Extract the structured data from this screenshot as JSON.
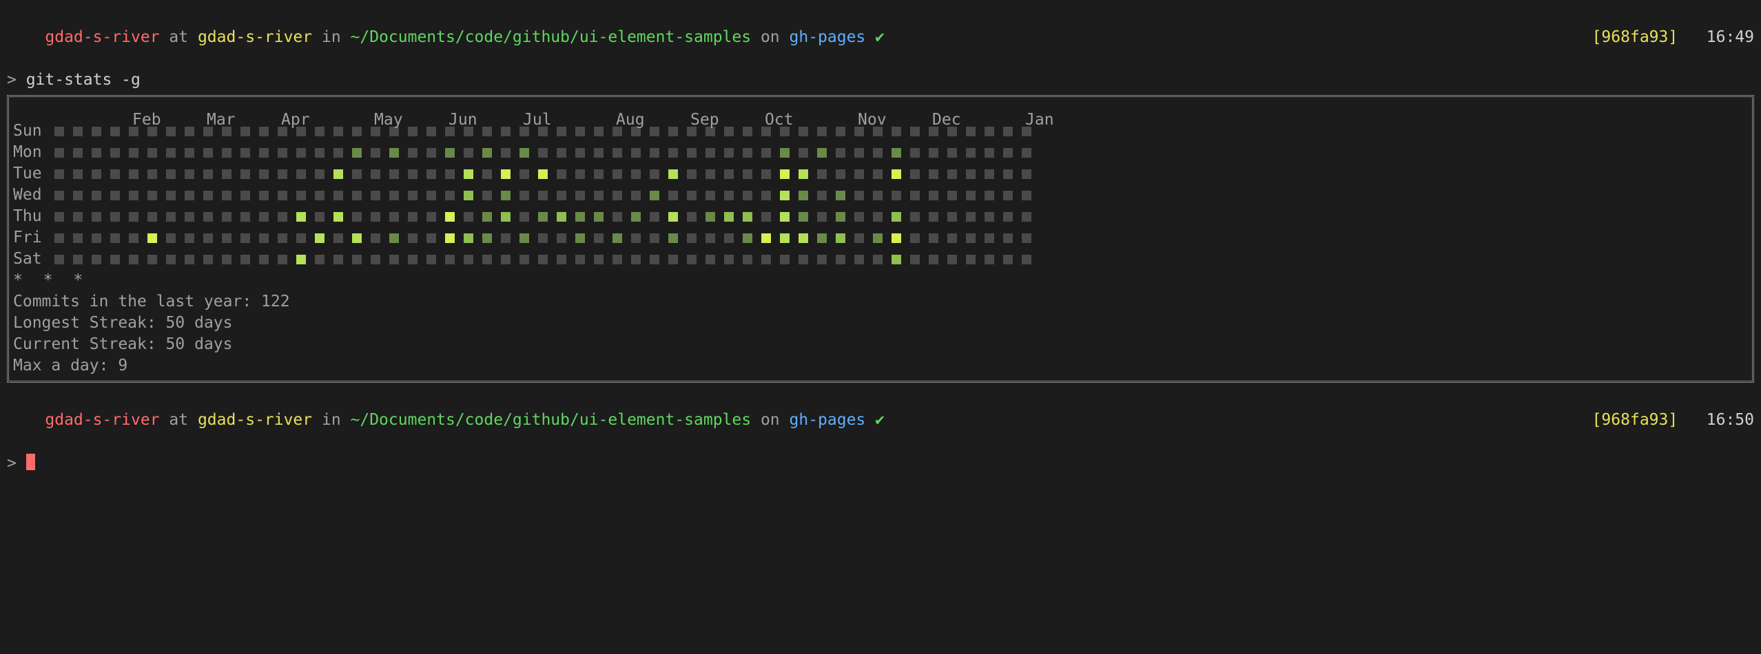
{
  "prompt1": {
    "user": "gdad-s-river",
    "at": " at ",
    "host": "gdad-s-river",
    "in": " in ",
    "path": "~/Documents/code/github/ui-element-samples",
    "on": " on ",
    "branch": "gh-pages",
    "check": " ✔",
    "hash": "[968fa93]",
    "time": "16:49",
    "caret": "> ",
    "command": "git-stats -g"
  },
  "months": [
    "Feb",
    "Mar",
    "Apr",
    "May",
    "Jun",
    "Jul",
    "Aug",
    "Sep",
    "Oct",
    "Nov",
    "Dec",
    "Jan"
  ],
  "month_offsets_weeks": [
    1,
    5,
    9,
    14,
    18,
    22,
    27,
    31,
    35,
    40,
    44,
    49
  ],
  "days": [
    "Sun",
    "Mon",
    "Tue",
    "Wed",
    "Thu",
    "Fri",
    "Sat"
  ],
  "grid": [
    "00000000000000000000000000000000000000000000000000000",
    "00000000000000001010010101000000000000010100010000000",
    "00000000000000030000003040400000030000043000040000000",
    "00000000000000000000002010000000100000031010000000000",
    "00000000000003030000040120121101030122031010020000000",
    "00000400000000303010042101001010010001433120140000000",
    "00000000000003000000000000000000000000000000020000000"
  ],
  "stars": "* * *",
  "stats": {
    "commits": "Commits in the last year: 122",
    "longest": "Longest Streak: 50 days",
    "current": "Current Streak: 50 days",
    "max": "Max a day: 9"
  },
  "prompt2": {
    "user": "gdad-s-river",
    "at": " at ",
    "host": "gdad-s-river",
    "in": " in ",
    "path": "~/Documents/code/github/ui-element-samples",
    "on": " on ",
    "branch": "gh-pages",
    "check": " ✔",
    "hash": "[968fa93]",
    "time": "16:50",
    "caret": "> "
  }
}
